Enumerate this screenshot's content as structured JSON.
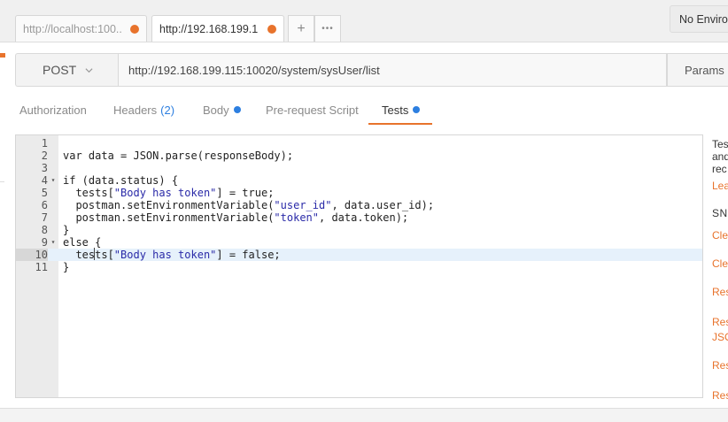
{
  "tabs": [
    {
      "label": "http://localhost:100..",
      "active": false
    },
    {
      "label": "http://192.168.199.1",
      "active": true
    }
  ],
  "tab_plus_label": "+",
  "tab_more_label": "•••",
  "environment": {
    "label": "No Enviro"
  },
  "request": {
    "method": "POST",
    "url": "http://192.168.199.115:10020/system/sysUser/list",
    "params_label": "Params"
  },
  "request_tabs": {
    "authorization": "Authorization",
    "headers": "Headers",
    "headers_count": "(2)",
    "body": "Body",
    "prerequest": "Pre-request Script",
    "tests": "Tests"
  },
  "editor": {
    "line_numbers": [
      "1",
      "2",
      "3",
      "4",
      "5",
      "6",
      "7",
      "8",
      "9",
      "10",
      "11"
    ],
    "lines": [
      "",
      "var data = JSON.parse(responseBody);",
      "",
      "if (data.status) {",
      "  tests[\"Body has token\"] = true;",
      "  postman.setEnvironmentVariable(\"user_id\", data.user_id);",
      "  postman.setEnvironmentVariable(\"token\", data.token);",
      "}",
      "else {",
      "  tests[\"Body has token\"] = false;",
      "}"
    ]
  },
  "snippets_panel": {
    "intro": [
      "Tes",
      "and",
      "rec"
    ],
    "learn_link": "Lea",
    "heading": "SNI",
    "items": [
      "Cle",
      "Cle",
      "Res",
      "Res",
      "JSO",
      "Res",
      "Res"
    ]
  },
  "colors": {
    "accent_orange": "#e8732c",
    "accent_blue": "#2d7fe0"
  }
}
